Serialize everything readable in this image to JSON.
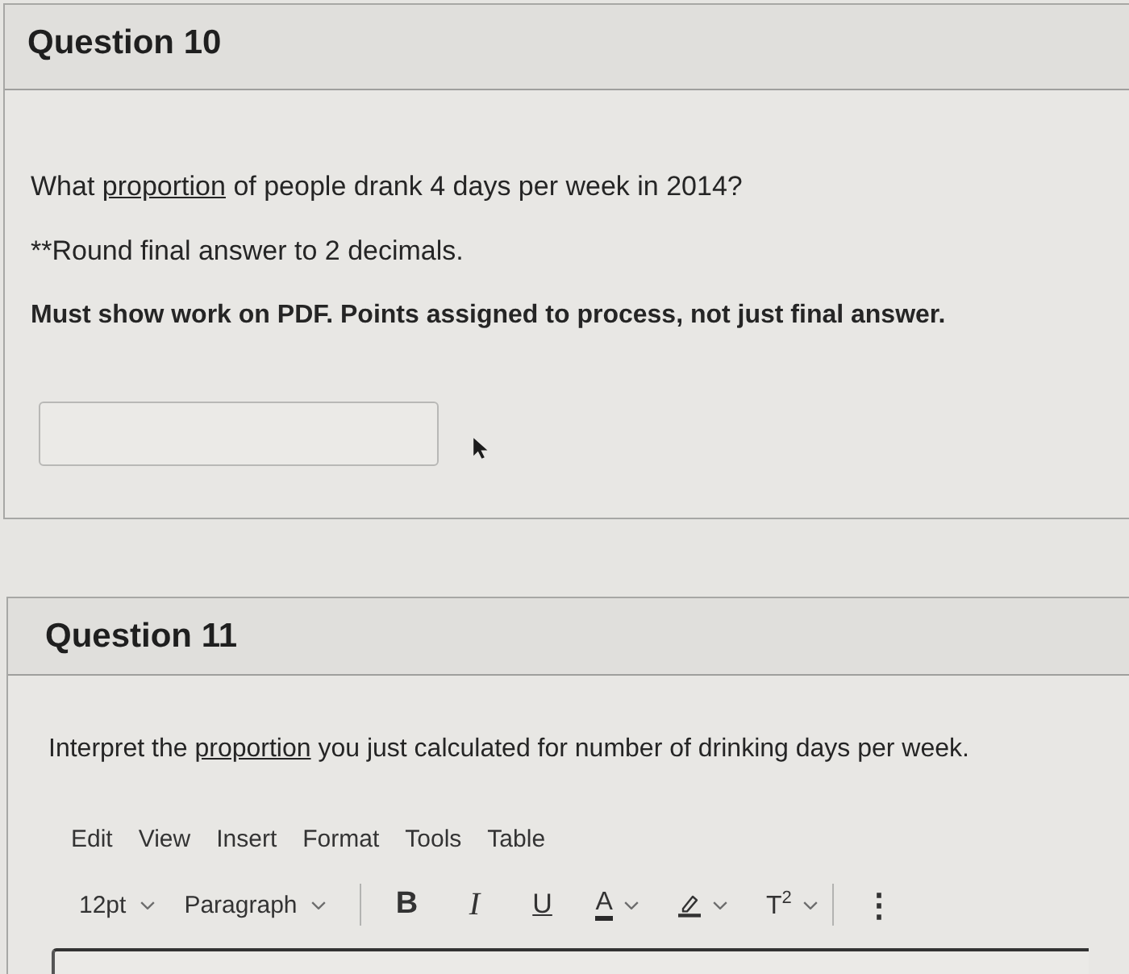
{
  "questions": [
    {
      "title": "Question 10",
      "paragraphs": [
        {
          "kind": "prompt",
          "parts": [
            {
              "kind": "text",
              "text": "What "
            },
            {
              "kind": "link",
              "text": "proportion"
            },
            {
              "kind": "text",
              "text": " of people drank 4 days per week in 2014?"
            }
          ]
        },
        {
          "kind": "prompt",
          "parts": [
            {
              "kind": "text",
              "text": "**Round final answer to 2 decimals."
            }
          ]
        },
        {
          "kind": "requirement",
          "parts": [
            {
              "kind": "text",
              "text": "Must show work on PDF. Points assigned to process, not just final answer."
            }
          ]
        }
      ],
      "answer": {
        "kind": "text_box"
      }
    },
    {
      "title": "Question 11",
      "paragraphs": [
        {
          "kind": "prompt",
          "parts": [
            {
              "kind": "text",
              "text": "Interpret the "
            },
            {
              "kind": "link",
              "text": "proportion"
            },
            {
              "kind": "text",
              "text": " you just calculated for number of drinking days per week."
            }
          ]
        }
      ],
      "answer": {
        "kind": "rich_editor",
        "menu": [
          "Edit",
          "View",
          "Insert",
          "Format",
          "Tools",
          "Table"
        ],
        "toolbar": [
          {
            "kind": "font_size",
            "label": "12pt"
          },
          {
            "kind": "block_format",
            "label": "Paragraph"
          },
          {
            "kind": "divider"
          },
          {
            "kind": "bold",
            "label": "B"
          },
          {
            "kind": "italic",
            "label": "I"
          },
          {
            "kind": "underline",
            "label": "U"
          },
          {
            "kind": "text_color",
            "label": "A"
          },
          {
            "kind": "highlight"
          },
          {
            "kind": "superscript",
            "label": "T$^{2}$"
          },
          {
            "kind": "divider"
          },
          {
            "kind": "more",
            "label": "⋮"
          }
        ]
      }
    }
  ]
}
